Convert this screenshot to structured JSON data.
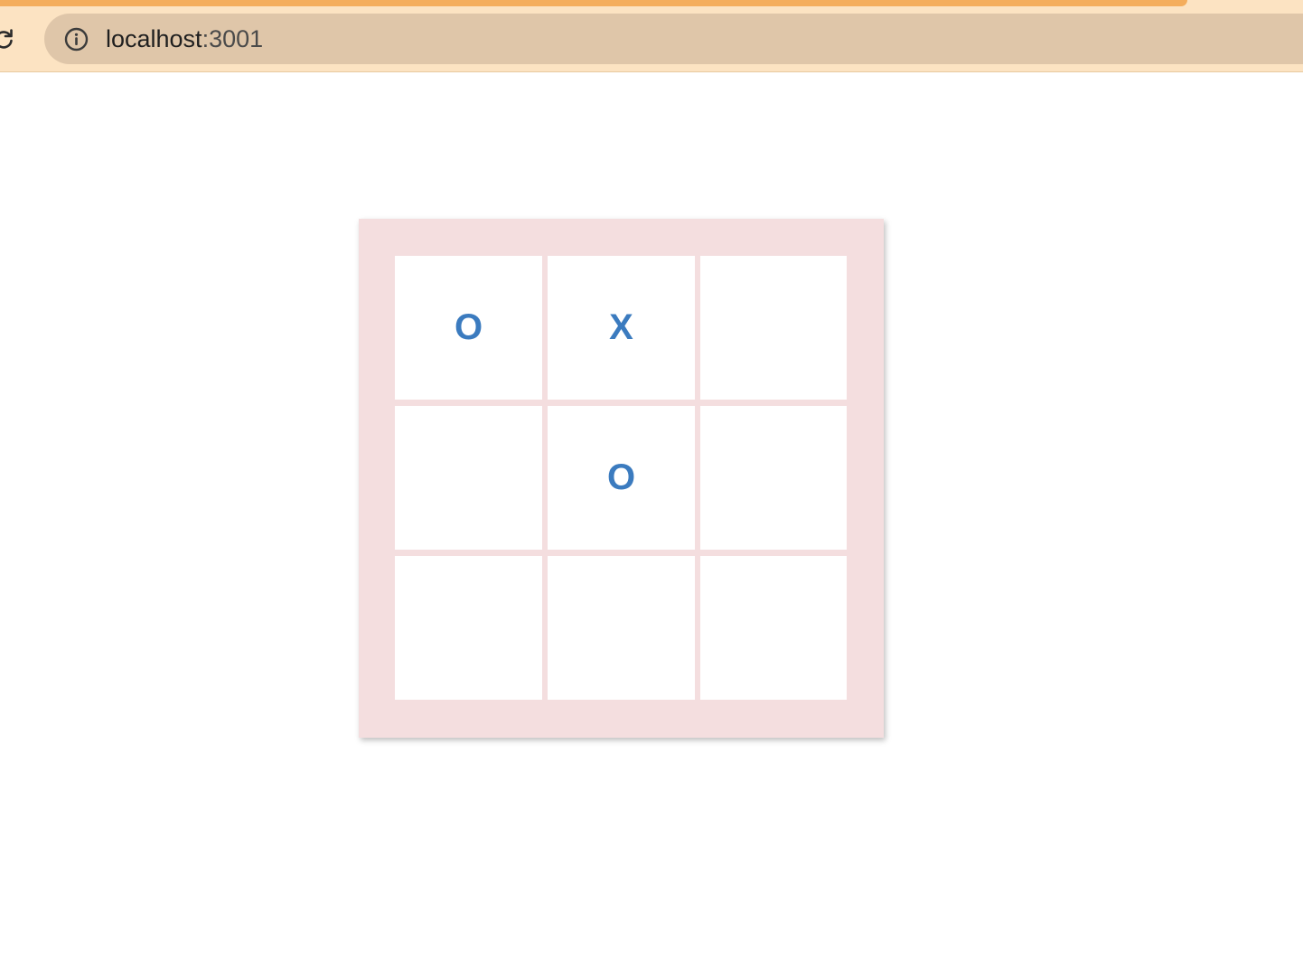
{
  "browser": {
    "url_host": "localhost",
    "url_port": ":3001",
    "icons": {
      "reload": "reload-icon",
      "site_info": "info-icon"
    },
    "colors": {
      "chrome_bg": "#fce3c2",
      "tab_accent": "#f4ad5c",
      "omnibox_bg": "#dfc6a9"
    }
  },
  "board": {
    "cells": [
      "O",
      "X",
      "",
      "",
      "O",
      "",
      "",
      "",
      ""
    ],
    "colors": {
      "frame": "#f4dedf",
      "cell": "#ffffff",
      "mark": "#3b7bbf"
    }
  }
}
